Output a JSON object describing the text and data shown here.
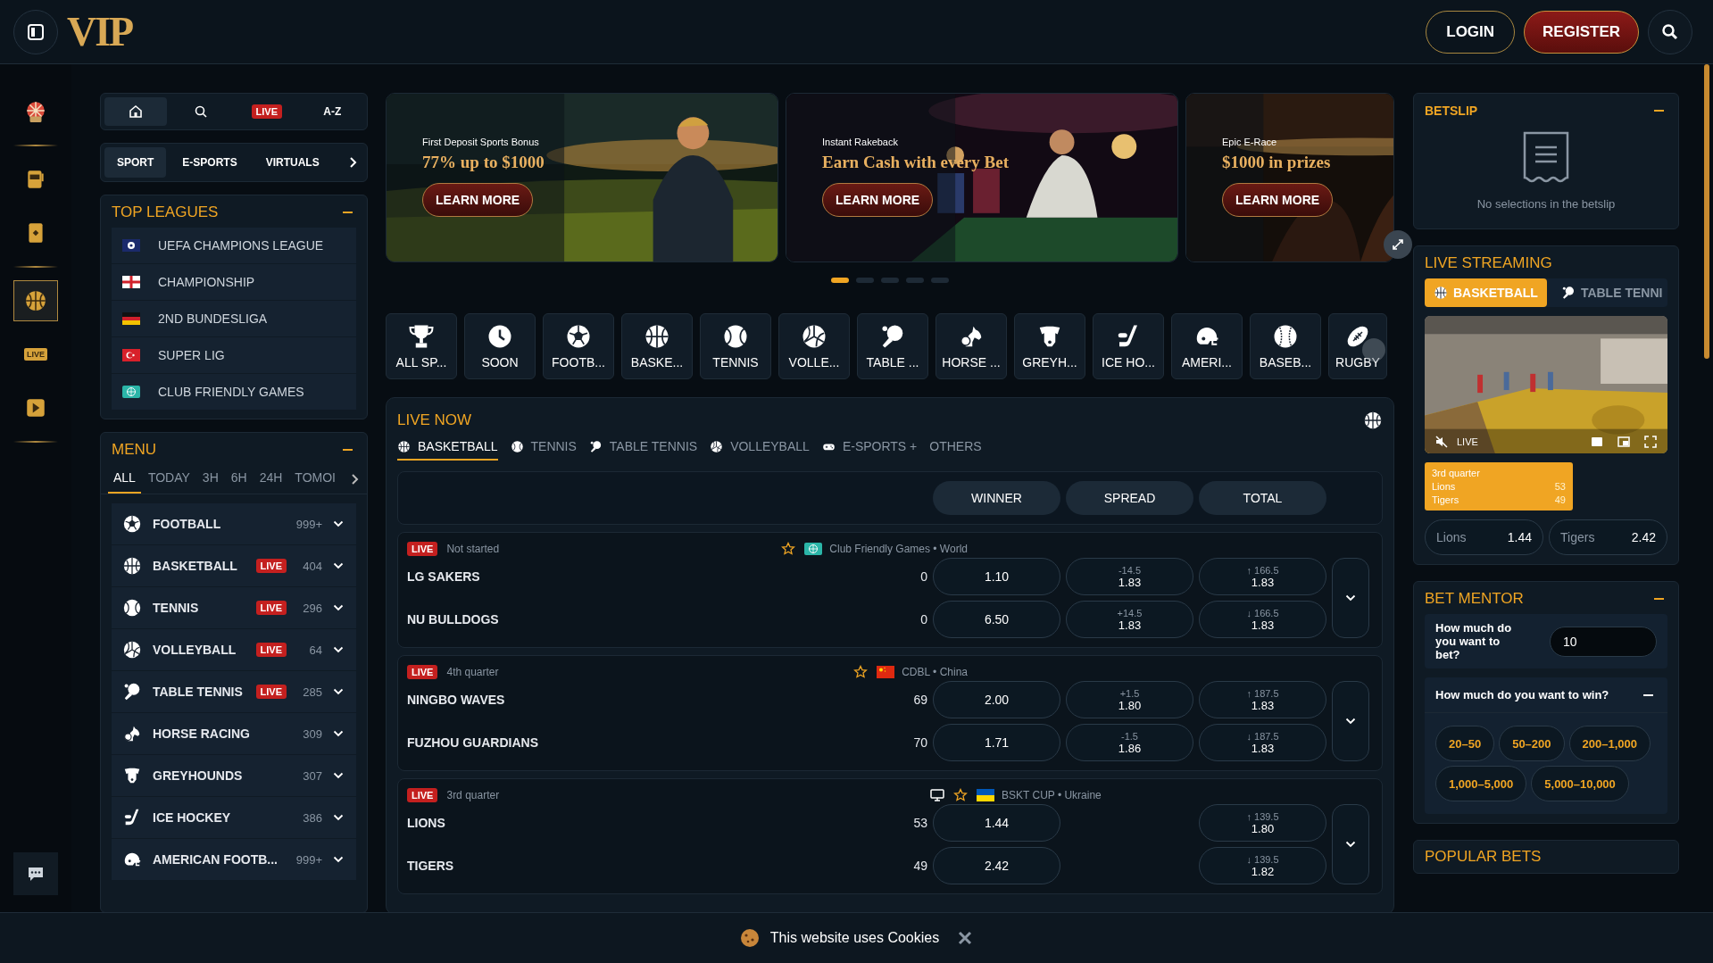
{
  "header": {
    "logo": "VIP",
    "login": "LOGIN",
    "register": "REGISTER"
  },
  "rail": [
    {
      "kind": "wheel",
      "selected": false
    },
    {
      "kind": "slot",
      "selected": false
    },
    {
      "kind": "card",
      "selected": false
    },
    {
      "kind": "ball",
      "selected": true
    },
    {
      "kind": "live",
      "label": "LIVE",
      "selected": false
    },
    {
      "kind": "play",
      "selected": false
    }
  ],
  "quick_tabs": [
    {
      "kind": "home",
      "selected": true
    },
    {
      "kind": "search",
      "selected": false
    },
    {
      "kind": "live",
      "label": "LIVE",
      "selected": false
    },
    {
      "kind": "az",
      "label": "A-Z",
      "selected": false
    }
  ],
  "section_tabs": [
    {
      "label": "SPORT",
      "selected": true
    },
    {
      "label": "E-SPORTS",
      "selected": false
    },
    {
      "label": "VIRTUALS",
      "selected": false
    }
  ],
  "top_leagues": {
    "title": "TOP LEAGUES",
    "items": [
      {
        "name": "UEFA CHAMPIONS LEAGUE",
        "kind": "uefa"
      },
      {
        "name": "CHAMPIONSHIP",
        "kind": "england"
      },
      {
        "name": "2ND BUNDESLIGA",
        "kind": "germany"
      },
      {
        "name": "SUPER LIG",
        "kind": "turkey"
      },
      {
        "name": "CLUB FRIENDLY GAMES",
        "kind": "world"
      }
    ]
  },
  "menu": {
    "title": "MENU",
    "filters": [
      {
        "label": "ALL",
        "selected": true
      },
      {
        "label": "TODAY",
        "selected": false
      },
      {
        "label": "3H",
        "selected": false
      },
      {
        "label": "6H",
        "selected": false
      },
      {
        "label": "24H",
        "selected": false
      },
      {
        "label": "TOMOI",
        "selected": false
      }
    ],
    "sports": [
      {
        "name": "FOOTBALL",
        "kind": "football",
        "count": "999+"
      },
      {
        "name": "BASKETBALL",
        "kind": "basketball",
        "badge": "LIVE",
        "count": "404"
      },
      {
        "name": "TENNIS",
        "kind": "tennis",
        "badge": "LIVE",
        "count": "296"
      },
      {
        "name": "VOLLEYBALL",
        "kind": "volleyball",
        "badge": "LIVE",
        "count": "64"
      },
      {
        "name": "TABLE TENNIS",
        "kind": "tabletennis",
        "badge": "LIVE",
        "count": "285"
      },
      {
        "name": "HORSE RACING",
        "kind": "horse",
        "count": "309"
      },
      {
        "name": "GREYHOUNDS",
        "kind": "dog",
        "count": "307"
      },
      {
        "name": "ICE HOCKEY",
        "kind": "hockey",
        "count": "386"
      },
      {
        "name": "AMERICAN FOOTB...",
        "kind": "helmet",
        "count": "999+"
      }
    ]
  },
  "banners": [
    {
      "kind": "stadium",
      "subtitle": "First Deposit Sports Bonus",
      "headline": "77% up to $1000",
      "button": "LEARN MORE"
    },
    {
      "kind": "casino",
      "subtitle": "Instant Rakeback",
      "headline": "Earn Cash with every Bet",
      "button": "LEARN MORE"
    },
    {
      "kind": "crowd",
      "subtitle": "Epic E-Race",
      "headline": "$1000 in prizes",
      "button": "LEARN MORE"
    }
  ],
  "banner_dots": [
    {
      "selected": true
    },
    {
      "selected": false
    },
    {
      "selected": false
    },
    {
      "selected": false
    },
    {
      "selected": false
    }
  ],
  "sports_bar": [
    {
      "label": "ALL SP...",
      "kind": "trophy"
    },
    {
      "label": "SOON",
      "kind": "clock"
    },
    {
      "label": "FOOTB...",
      "kind": "football"
    },
    {
      "label": "BASKE...",
      "kind": "basketball"
    },
    {
      "label": "TENNIS",
      "kind": "tennis"
    },
    {
      "label": "VOLLE...",
      "kind": "volleyball"
    },
    {
      "label": "TABLE ...",
      "kind": "tabletennis"
    },
    {
      "label": "HORSE ...",
      "kind": "horse"
    },
    {
      "label": "GREYH...",
      "kind": "dog"
    },
    {
      "label": "ICE HO...",
      "kind": "hockey"
    },
    {
      "label": "AMERI...",
      "kind": "helmet"
    },
    {
      "label": "BASEB...",
      "kind": "baseball"
    },
    {
      "label": "RUGBY",
      "kind": "rugby"
    }
  ],
  "live_now": {
    "title": "LIVE NOW",
    "tabs": [
      {
        "label": "BASKETBALL",
        "kind": "basketball",
        "selected": true
      },
      {
        "label": "TENNIS",
        "kind": "tennis",
        "selected": false
      },
      {
        "label": "TABLE TENNIS",
        "kind": "tabletennis",
        "selected": false
      },
      {
        "label": "VOLLEYBALL",
        "kind": "volleyball",
        "selected": false
      },
      {
        "label": "E-SPORTS +",
        "kind": "gamepad",
        "selected": false
      },
      {
        "label": "OTHERS",
        "selected": false
      }
    ],
    "markets": [
      "WINNER",
      "SPREAD",
      "TOTAL"
    ],
    "matches": [
      {
        "badge": "LIVE",
        "status": "Not started",
        "stream": false,
        "league": "Club Friendly Games • World",
        "kind": "world",
        "teams": [
          {
            "name": "LG SAKERS",
            "score": "0",
            "winner": "1.10",
            "spread_line": "-14.5",
            "spread": "1.83",
            "total_line": "↑ 166.5",
            "total": "1.83"
          },
          {
            "name": "NU BULLDOGS",
            "score": "0",
            "winner": "6.50",
            "spread_line": "+14.5",
            "spread": "1.83",
            "total_line": "↓ 166.5",
            "total": "1.83"
          }
        ]
      },
      {
        "badge": "LIVE",
        "status": "4th quarter",
        "stream": false,
        "league": "CDBL • China",
        "kind": "china",
        "teams": [
          {
            "name": "NINGBO WAVES",
            "score": "69",
            "winner": "2.00",
            "spread_line": "+1.5",
            "spread": "1.80",
            "total_line": "↑ 187.5",
            "total": "1.83"
          },
          {
            "name": "FUZHOU GUARDIANS",
            "score": "70",
            "winner": "1.71",
            "spread_line": "-1.5",
            "spread": "1.86",
            "total_line": "↓ 187.5",
            "total": "1.83"
          }
        ]
      },
      {
        "badge": "LIVE",
        "status": "3rd quarter",
        "stream": true,
        "league": "BSKT CUP • Ukraine",
        "kind": "ukraine",
        "teams": [
          {
            "name": "LIONS",
            "score": "53",
            "winner": "1.44",
            "total_line": "↑ 139.5",
            "total": "1.80"
          },
          {
            "name": "TIGERS",
            "score": "49",
            "winner": "2.42",
            "total_line": "↓ 139.5",
            "total": "1.82"
          }
        ]
      }
    ]
  },
  "betslip": {
    "title": "BETSLIP",
    "empty": "No selections in the betslip"
  },
  "live_streaming": {
    "title": "LIVE STREAMING",
    "tabs": [
      {
        "label": "BASKETBALL",
        "kind": "basketball",
        "selected": true
      },
      {
        "label": "TABLE TENNI",
        "kind": "tabletennis",
        "selected": false
      }
    ],
    "video_label": "LIVE",
    "score": {
      "period": "3rd quarter",
      "rows": [
        {
          "team": "Lions",
          "score": "53"
        },
        {
          "team": "Tigers",
          "score": "49"
        }
      ]
    },
    "odds": [
      {
        "team": "Lions",
        "odd": "1.44"
      },
      {
        "team": "Tigers",
        "odd": "2.42"
      }
    ]
  },
  "bet_mentor": {
    "title": "BET MENTOR",
    "bet_question": "How much do you want to bet?",
    "bet_value": "10",
    "win_question": "How much do you want to win?",
    "ranges": [
      "20–50",
      "50–200",
      "200–1,000",
      "1,000–5,000",
      "5,000–10,000"
    ]
  },
  "popular_bets": {
    "title": "POPULAR BETS"
  },
  "cookie": {
    "text": "This website uses Cookies"
  }
}
